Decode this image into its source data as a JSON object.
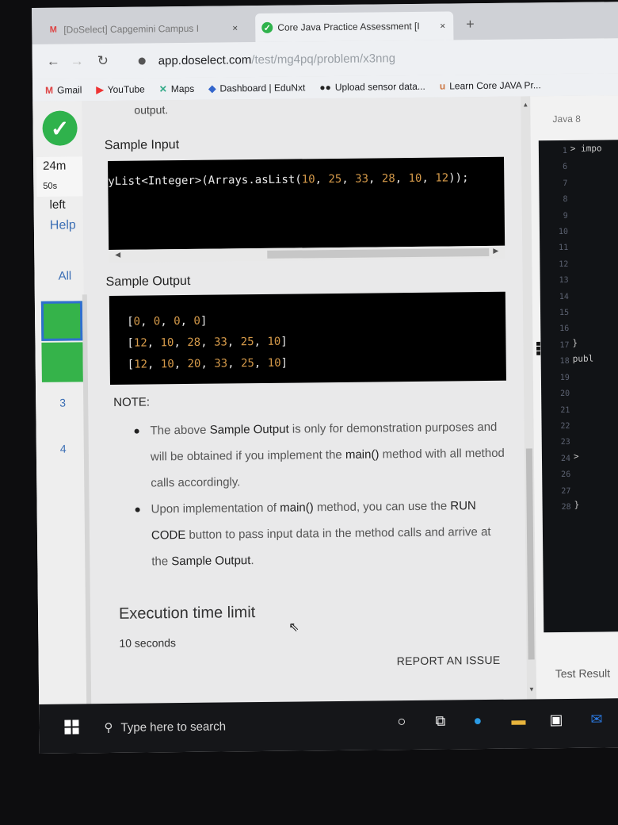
{
  "tabs": [
    {
      "label": "[DoSelect] Capgemini Campus I",
      "icon": "gmail-icon",
      "close": "×"
    },
    {
      "label": "Core Java Practice Assessment [I",
      "icon": "check-circle-icon",
      "close": "×"
    }
  ],
  "new_tab": "+",
  "address": {
    "host": "app.doselect.com",
    "path": "/test/mg4pq/problem/x3nng"
  },
  "bookmarks": [
    {
      "label": "Gmail",
      "icon": "gmail-icon"
    },
    {
      "label": "YouTube",
      "icon": "youtube-icon"
    },
    {
      "label": "Maps",
      "icon": "maps-icon"
    },
    {
      "label": "Dashboard | EduNxt",
      "icon": "diamond-icon"
    },
    {
      "label": "Upload sensor data...",
      "icon": "dots-icon"
    },
    {
      "label": "Learn Core JAVA Pr...",
      "icon": "udemy-icon"
    }
  ],
  "sidebar": {
    "timer_main": "24m",
    "timer_sec": "50s",
    "timer_left": "left",
    "help": "Help",
    "all": "All",
    "question_numbers": [
      "3",
      "4"
    ]
  },
  "content": {
    "prev_fragment": "output.",
    "sample_input_title": "Sample Input",
    "sample_input_code": {
      "prefix": "yList<Integer>(Arrays.asList(",
      "nums": [
        "10",
        "25",
        "33",
        "28",
        "10",
        "12"
      ],
      "suffix": "));"
    },
    "sample_output_title": "Sample Output",
    "sample_output_lines": [
      [
        "0",
        "0",
        "0",
        "0"
      ],
      [
        "12",
        "10",
        "28",
        "33",
        "25",
        "10"
      ],
      [
        "12",
        "10",
        "20",
        "33",
        "25",
        "10"
      ]
    ],
    "note_title": "NOTE:",
    "bullets": [
      {
        "pre": "The above ",
        "b1": "Sample Output",
        "mid": " is only for demonstration purposes and will be obtained if you implement the ",
        "b2": "main()",
        "post": " method with all method calls accordingly."
      },
      {
        "pre": "Upon implementation of ",
        "b1": "main()",
        "mid": " method, you can use the ",
        "b2": "RUN CODE",
        "post": " button to pass input data in the method calls and arrive at the ",
        "b3": "Sample Output",
        "post2": "."
      }
    ],
    "exec_title": "Execution time limit",
    "exec_value": "10 seconds",
    "report": "REPORT AN ISSUE"
  },
  "editor": {
    "language": "Java 8",
    "line_numbers": [
      "1",
      "6",
      "7",
      "8",
      "9",
      "10",
      "11",
      "12",
      "13",
      "14",
      "15",
      "16",
      "17",
      "18",
      "19",
      "20",
      "21",
      "22",
      "23",
      "24",
      "26",
      "27",
      "28"
    ],
    "visible_code": [
      {
        "row": 0,
        "text": "> impo"
      },
      {
        "row": 12,
        "text": "  }"
      },
      {
        "row": 13,
        "text": "  publ"
      },
      {
        "row": 19,
        "text": ">"
      },
      {
        "row": 22,
        "text": "  }"
      }
    ],
    "test_results": "Test Result"
  },
  "taskbar": {
    "search_placeholder": "Type here to search"
  }
}
